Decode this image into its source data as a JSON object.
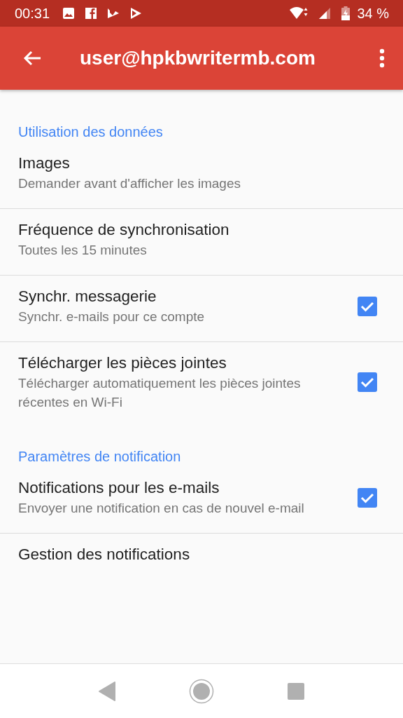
{
  "status_bar": {
    "time": "00:31",
    "battery": "34 %"
  },
  "app_bar": {
    "title": "user@hpkbwritermb.com"
  },
  "rows": [
    {
      "kind": "header",
      "title": "Utilisation des données"
    },
    {
      "kind": "plain",
      "title": "Images",
      "subtitle": "Demander avant d'afficher les images"
    },
    {
      "kind": "plain",
      "title": "Fréquence de synchronisation",
      "subtitle": "Toutes les 15 minutes"
    },
    {
      "kind": "checkbox",
      "title": "Synchr. messagerie",
      "subtitle": "Synchr. e-mails pour ce compte",
      "checked": true
    },
    {
      "kind": "checkbox",
      "title": "Télécharger les pièces jointes",
      "subtitle": "Télécharger automatiquement les pièces jointes récentes en Wi-Fi",
      "checked": true
    },
    {
      "kind": "header",
      "title": "Paramètres de notification"
    },
    {
      "kind": "checkbox",
      "title": "Notifications pour les e-mails",
      "subtitle": "Envoyer une notification en cas de nouvel e-mail",
      "checked": true
    },
    {
      "kind": "plain",
      "title": "Gestion des notifications"
    }
  ]
}
